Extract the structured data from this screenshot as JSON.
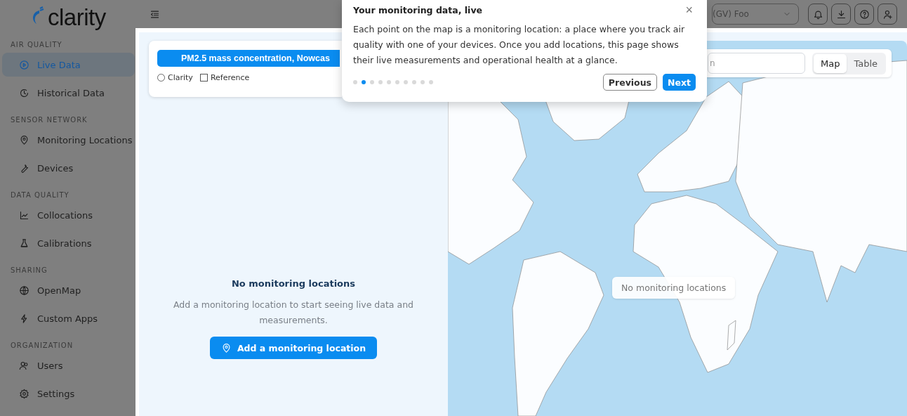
{
  "logo": {
    "text": "clarity"
  },
  "sidebar": {
    "sections": [
      {
        "title": "AIR QUALITY",
        "items": [
          {
            "label": "Live Data",
            "selected": true
          },
          {
            "label": "Historical Data",
            "selected": false
          }
        ]
      },
      {
        "title": "SENSOR NETWORK",
        "items": [
          {
            "label": "Monitoring Locations",
            "selected": false
          },
          {
            "label": "Devices",
            "selected": false
          }
        ]
      },
      {
        "title": "DATA QUALITY",
        "items": [
          {
            "label": "Collocations",
            "selected": false
          },
          {
            "label": "Calibrations",
            "selected": false
          }
        ]
      },
      {
        "title": "SHARING",
        "items": [
          {
            "label": "OpenMap",
            "selected": false
          },
          {
            "label": "Custom Apps",
            "selected": false
          }
        ]
      },
      {
        "title": "ORGANIZATION",
        "items": [
          {
            "label": "Users",
            "selected": false
          },
          {
            "label": "Settings",
            "selected": false
          }
        ]
      }
    ]
  },
  "topbar": {
    "org_select": {
      "value": "(GV) Foo"
    }
  },
  "panel": {
    "metric_button": "PM2.5 mass concentration, Nowcas",
    "sources": [
      {
        "kind": "radio",
        "label": "Clarity",
        "checked": false
      },
      {
        "kind": "checkbox",
        "label": "Reference",
        "checked": false
      }
    ],
    "empty_state": {
      "title": "No monitoring locations",
      "message": "Add a monitoring location to start seeing live data and measurements.",
      "button": "Add a monitoring location"
    }
  },
  "map": {
    "search": {
      "placeholder": "n"
    },
    "view_toggle": [
      {
        "label": "Map",
        "selected": true
      },
      {
        "label": "Table",
        "selected": false
      }
    ],
    "empty_label": "No monitoring locations"
  },
  "tour": {
    "title": "Your monitoring data, live",
    "close": "×",
    "body": "Each point on the map is a monitoring location: a place where you track air quality with one of your devices. Once you add locations, this page shows their live measurements and operational health at a glance.",
    "steps": [
      {
        "selected": false
      },
      {
        "selected": true
      },
      {
        "selected": false
      },
      {
        "selected": false
      },
      {
        "selected": false
      },
      {
        "selected": false
      },
      {
        "selected": false
      },
      {
        "selected": false
      },
      {
        "selected": false
      },
      {
        "selected": false
      }
    ],
    "buttons": {
      "previous": "Previous",
      "next": "Next"
    }
  }
}
